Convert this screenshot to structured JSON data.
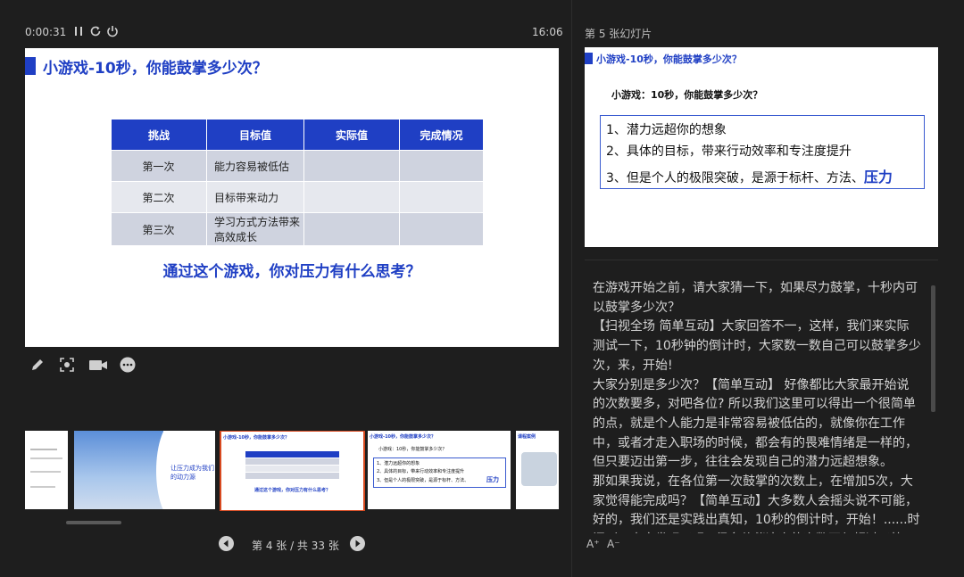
{
  "presenter": {
    "elapsed": "0:00:31",
    "clock": "16:06",
    "next_slide_label": "第 5 张幻灯片",
    "pager": "第 4 张 / 共 33 张"
  },
  "current_slide": {
    "title": "小游戏-10秒，你能鼓掌多少次？",
    "table": {
      "headers": [
        "挑战",
        "目标值",
        "实际值",
        "完成情况"
      ],
      "rows": [
        [
          "第一次",
          "能力容易被低估",
          "",
          ""
        ],
        [
          "第二次",
          "目标带来动力",
          "",
          ""
        ],
        [
          "第三次",
          "学习方式方法带来高效成长",
          "",
          ""
        ]
      ]
    },
    "question": "通过这个游戏，你对压力有什么思考？",
    "accent": "#1f3fc4"
  },
  "thumbnails": {
    "t2_text": "让压力成为我们的动力源",
    "t3_title": "小游戏-10秒，你能鼓掌多少次？",
    "t3_question": "通过这个游戏，你对压力有什么思考？",
    "t4_title": "小游戏-10秒，你能鼓掌多少次？",
    "t4_sub": "小游戏：10秒，你能鼓掌多少次？",
    "t4_lines": [
      "1、潜力远超你的想象",
      "2、具体的目标，带来行动效率和专注度提升",
      "3、但是个人的极限突破，是源于标杆、方法、",
      "压力"
    ],
    "t5_title": "课程案例"
  },
  "next_slide": {
    "title": "小游戏-10秒，你能鼓掌多少次？",
    "subtitle": "小游戏：10秒，你能鼓掌多少次？",
    "line1": "1、潜力远超你的想象",
    "line2": "2、具体的目标，带来行动效率和专注度提升",
    "line3": "3、但是个人的极限突破，是源于标杆、方法、",
    "line3_emph": "压力"
  },
  "notes": {
    "p1": "在游戏开始之前，请大家猜一下，如果尽力鼓掌，十秒内可以鼓掌多少次？",
    "p2": "【扫视全场 简单互动】大家回答不一，这样，我们来实际测试一下，10秒钟的倒计时，大家数一数自己可以鼓掌多少次，来，开始!",
    "p3": "大家分别是多少次？【简单互动】 好像都比大家最开始说的次数要多，对吧各位? 所以我们这里可以得出一个很简单的点，就是个人能力是非常容易被低估的，就像你在工作中，或者才走入职场的时候，都会有的畏难情绪是一样的，但只要迈出第一步，往往会发现自己的潜力远超想象。",
    "p4": "那如果我说，在各位第一次鼓掌的次数上，在增加5次，大家觉得能完成吗？【简单互动】大多数人会摇头说不可能，好的，我们还是实践出真知，10秒的倒计时，开始！......时间到。大家发现了吗? 很多伙伴这次的次数不仅超过了第一次，甚至接近或达到了"
  },
  "font_buttons": {
    "increase": "A⁺",
    "decrease": "A⁻"
  },
  "icons": [
    "pause-icon",
    "restart-icon",
    "power-icon",
    "pen-icon",
    "focus-icon",
    "camera-icon",
    "more-icon",
    "prev-icon",
    "next-icon"
  ]
}
